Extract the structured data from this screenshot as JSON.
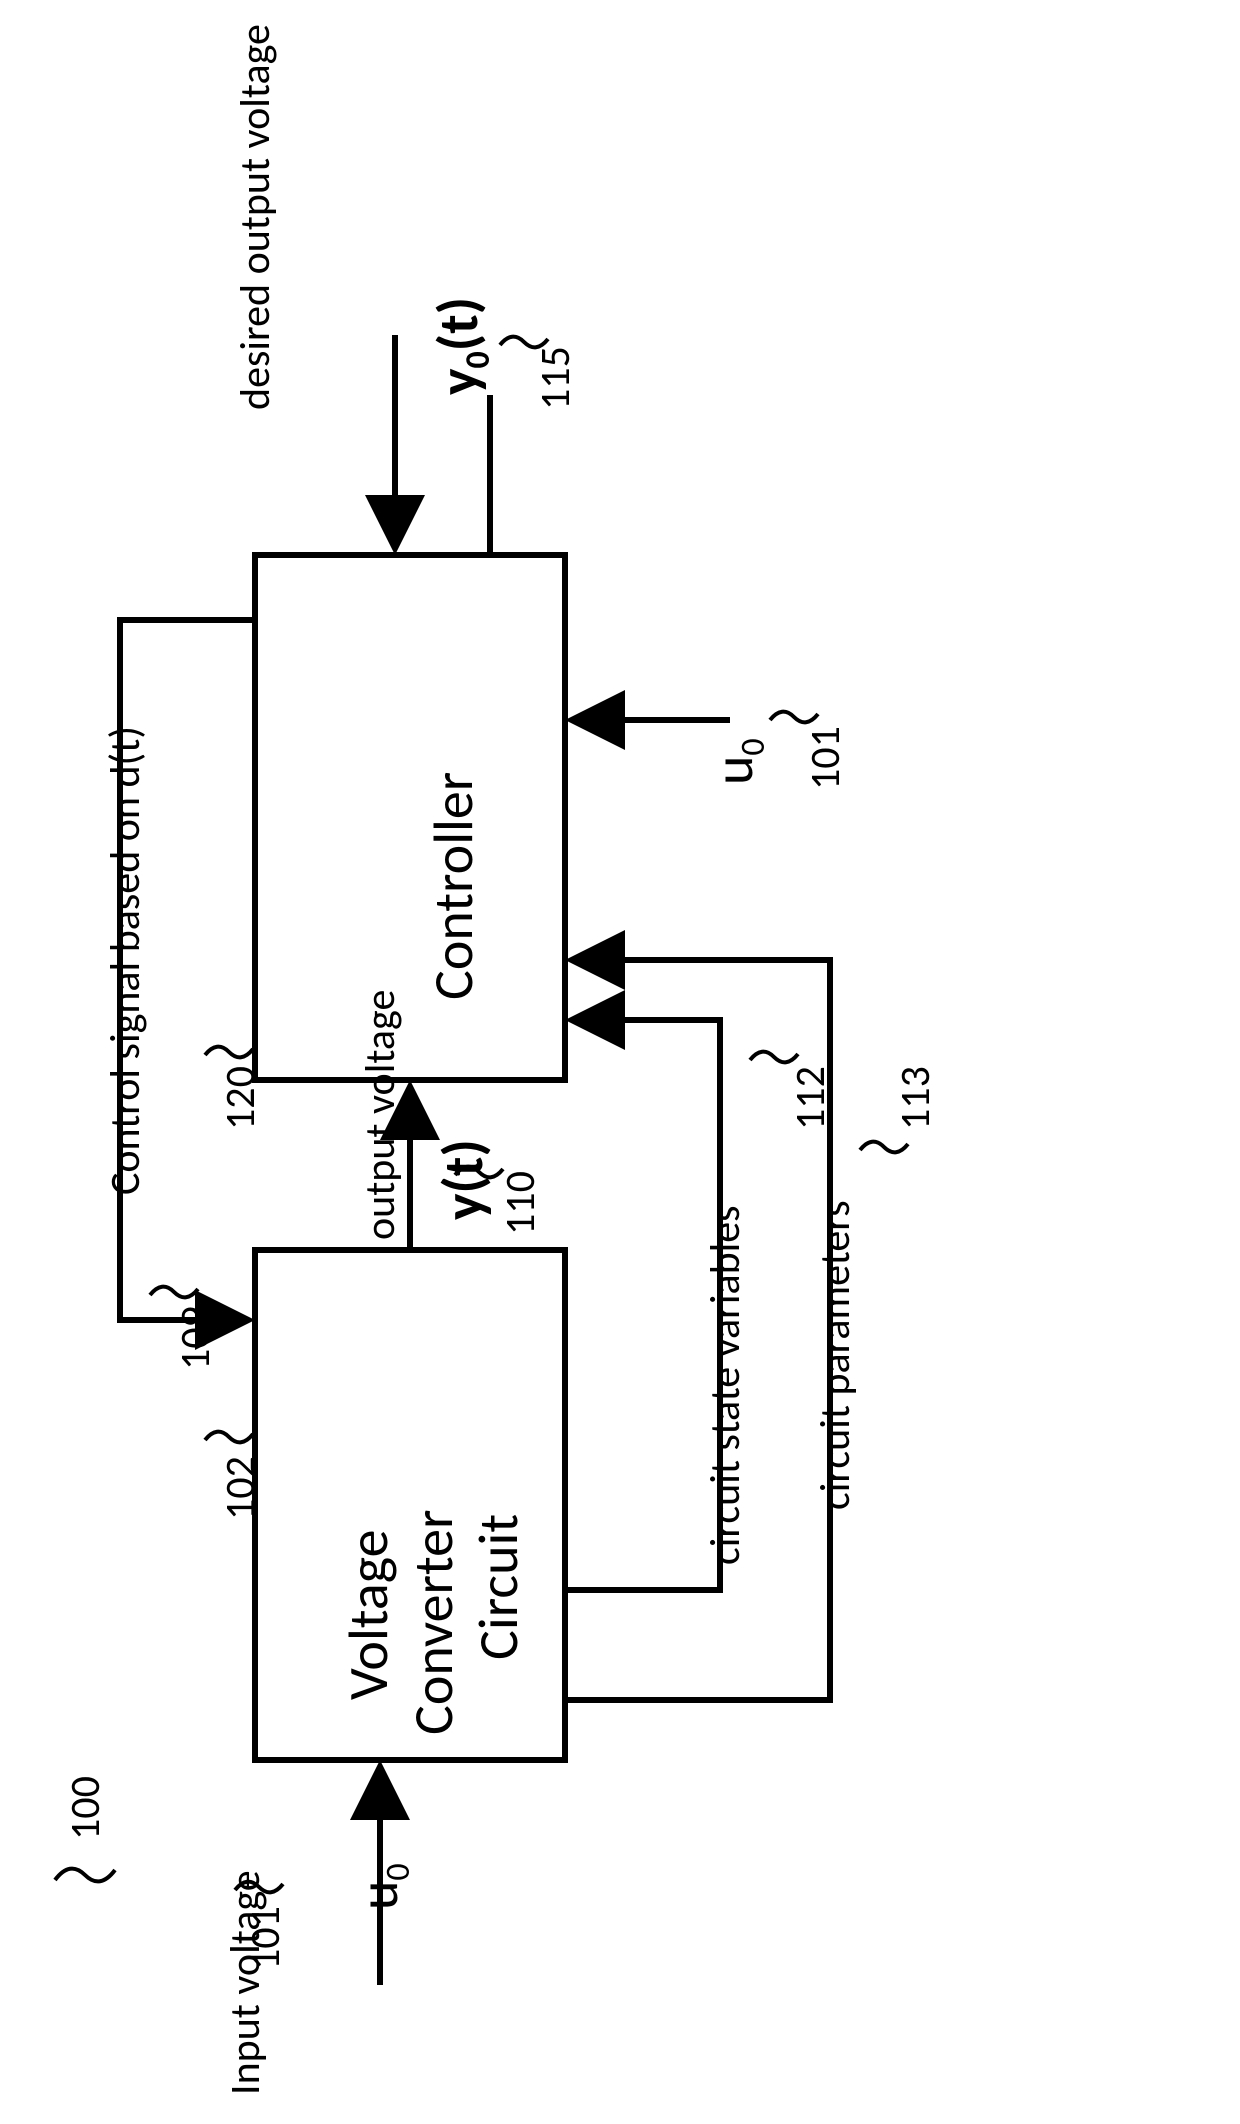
{
  "refs": {
    "system": "100",
    "input_voltage_ref": "101",
    "converter_ref": "102",
    "control_signal_ref": "109",
    "output_voltage_ref": "110",
    "controller_ref": "120",
    "state_vars_ref": "112",
    "params_ref": "113",
    "controller_u0_ref": "101",
    "desired_output_ref": "115"
  },
  "text": {
    "input_voltage": "Input voltage",
    "u0_base": "u",
    "u0_sub": "0",
    "converter_block": "Voltage Converter Circuit",
    "control_signal": "Control signal based on d(t)",
    "output_voltage": "output voltage",
    "y_t": "y(t)",
    "state_vars": "circuit state variables",
    "circuit_params": "circuit parameters",
    "controller_block": "Controller",
    "desired_output": "desired output voltage",
    "y0_base": "y",
    "y0_sub": "0",
    "y0_suffix": "(t)"
  }
}
